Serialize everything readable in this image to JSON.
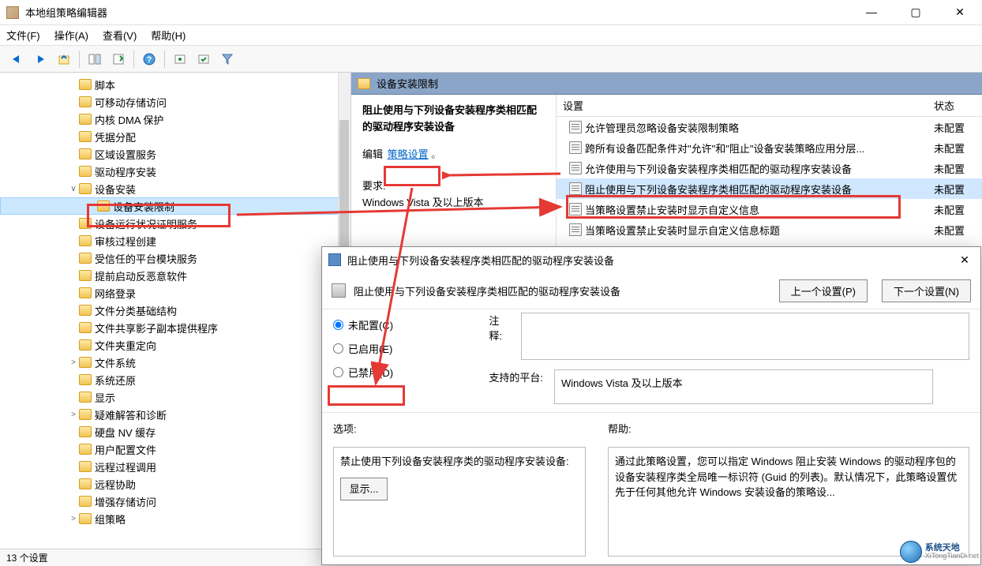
{
  "window": {
    "title": "本地组策略编辑器"
  },
  "menu": {
    "file": "文件(F)",
    "action": "操作(A)",
    "view": "查看(V)",
    "help": "帮助(H)"
  },
  "tree": {
    "items": [
      {
        "label": "脚本",
        "indent": 100
      },
      {
        "label": "可移动存储访问",
        "indent": 100
      },
      {
        "label": "内核 DMA 保护",
        "indent": 100
      },
      {
        "label": "凭据分配",
        "indent": 100
      },
      {
        "label": "区域设置服务",
        "indent": 100
      },
      {
        "label": "驱动程序安装",
        "indent": 100
      },
      {
        "label": "设备安装",
        "indent": 100,
        "expander": "∨"
      },
      {
        "label": "设备安装限制",
        "indent": 122,
        "selected": true
      },
      {
        "label": "设备运行状况证明服务",
        "indent": 100
      },
      {
        "label": "审核过程创建",
        "indent": 100
      },
      {
        "label": "受信任的平台模块服务",
        "indent": 100
      },
      {
        "label": "提前启动反恶意软件",
        "indent": 100
      },
      {
        "label": "网络登录",
        "indent": 100
      },
      {
        "label": "文件分类基础结构",
        "indent": 100
      },
      {
        "label": "文件共享影子副本提供程序",
        "indent": 100
      },
      {
        "label": "文件夹重定向",
        "indent": 100
      },
      {
        "label": "文件系统",
        "indent": 100,
        "expander": ">"
      },
      {
        "label": "系统还原",
        "indent": 100
      },
      {
        "label": "显示",
        "indent": 100
      },
      {
        "label": "疑难解答和诊断",
        "indent": 100,
        "expander": ">"
      },
      {
        "label": "硬盘 NV 缓存",
        "indent": 100
      },
      {
        "label": "用户配置文件",
        "indent": 100
      },
      {
        "label": "远程过程调用",
        "indent": 100
      },
      {
        "label": "远程协助",
        "indent": 100
      },
      {
        "label": "增强存储访问",
        "indent": 100
      },
      {
        "label": "组策略",
        "indent": 100,
        "expander": ">"
      }
    ]
  },
  "right": {
    "header": "设备安装限制",
    "policy_title": "阻止使用与下列设备安装程序类相匹配的驱动程序安装设备",
    "edit_label": "编辑",
    "edit_link": "策略设置",
    "req_label": "要求:",
    "req_value": "Windows Vista 及以上版本",
    "columns": {
      "setting": "设置",
      "state": "状态"
    },
    "rows": [
      {
        "text": "允许管理员忽略设备安装限制策略",
        "state": "未配置"
      },
      {
        "text": "跨所有设备匹配条件对\"允许\"和\"阻止\"设备安装策略应用分层...",
        "state": "未配置"
      },
      {
        "text": "允许使用与下列设备安装程序类相匹配的驱动程序安装设备",
        "state": "未配置"
      },
      {
        "text": "阻止使用与下列设备安装程序类相匹配的驱动程序安装设备",
        "state": "未配置",
        "highlighted": true
      },
      {
        "text": "当策略设置禁止安装时显示自定义信息",
        "state": "未配置"
      },
      {
        "text": "当策略设置禁止安装时显示自定义信息标题",
        "state": "未配置"
      }
    ]
  },
  "dialog": {
    "title": "阻止使用与下列设备安装程序类相匹配的驱动程序安装设备",
    "subtitle": "阻止使用与下列设备安装程序类相匹配的驱动程序安装设备",
    "prev_btn": "上一个设置(P)",
    "next_btn": "下一个设置(N)",
    "radio_notconf": "未配置(C)",
    "radio_enabled": "已启用(E)",
    "radio_disabled": "已禁用(D)",
    "comment_label": "注释:",
    "platform_label": "支持的平台:",
    "platform_value": "Windows Vista 及以上版本",
    "options_label": "选项:",
    "help_label": "帮助:",
    "options_text": "禁止使用下列设备安装程序类的驱动程序安装设备:",
    "show_btn": "显示...",
    "help_text": "通过此策略设置，您可以指定 Windows 阻止安装 Windows 的驱动程序包的设备安装程序类全局唯一标识符 (Guid 的列表)。默认情况下，此策略设置优先于任何其他允许 Windows 安装设备的策略设..."
  },
  "statusbar": "13 个设置",
  "watermark": {
    "cn": "系统天地",
    "en": "XiTongTianDi.net"
  }
}
